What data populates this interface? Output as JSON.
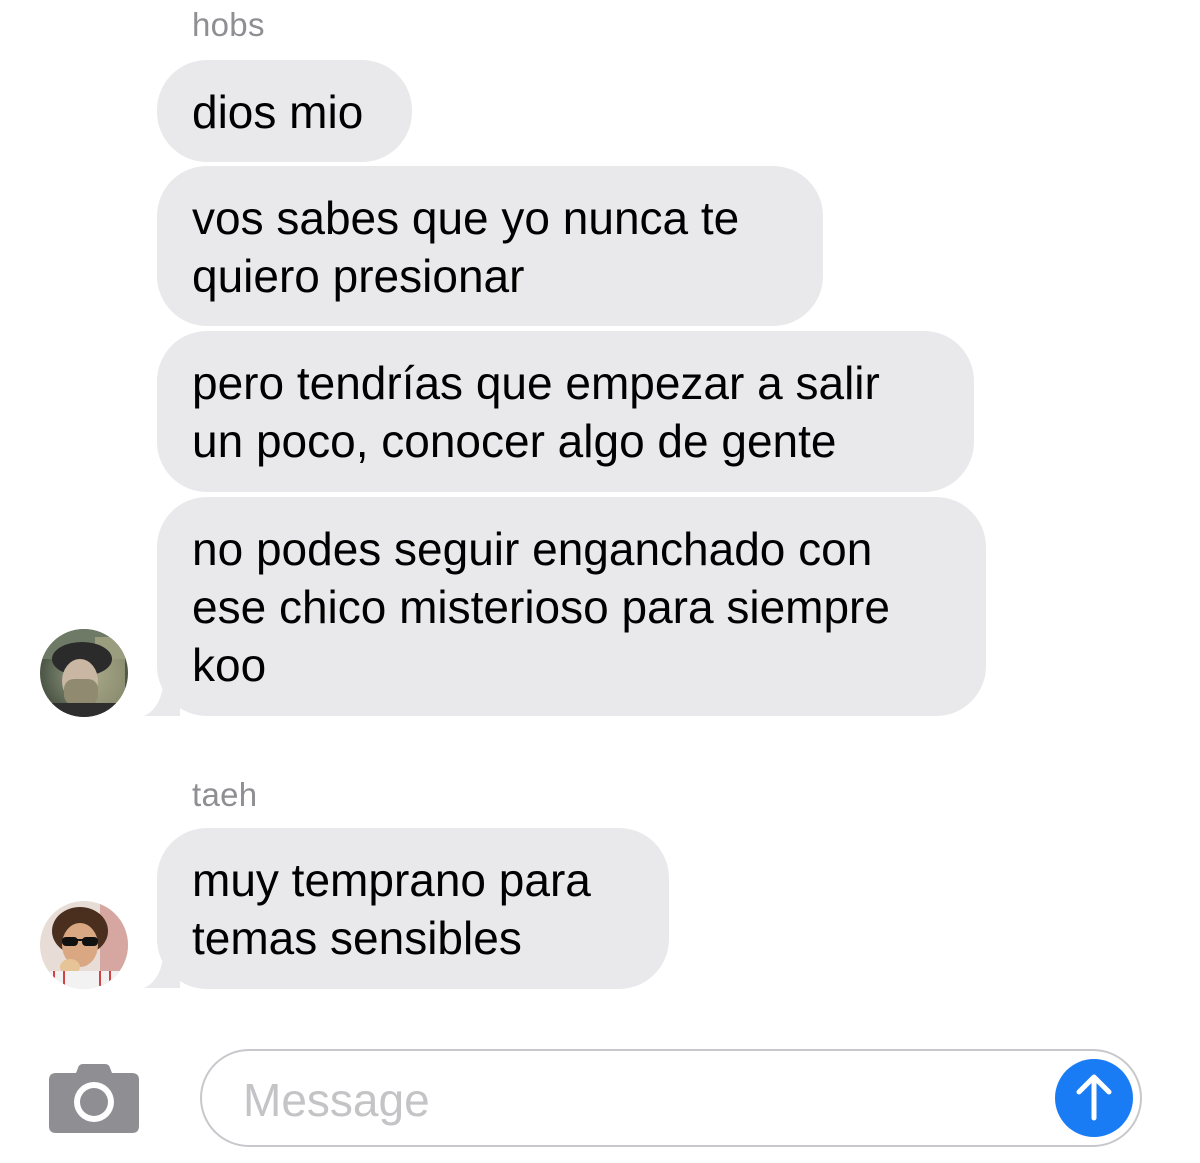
{
  "thread": {
    "groups": [
      {
        "sender": "hobs",
        "messages": [
          "dios mio",
          "vos sabes que yo nunca te\nquiero presionar",
          "pero tendrías que empezar a salir\nun poco, conocer algo de gente",
          "no podes seguir enganchado con\nese chico misterioso para siempre\nkoo"
        ],
        "avatar": "profile-photo-masked-person"
      },
      {
        "sender": "taeh",
        "messages": [
          "muy temprano para\ntemas sensibles"
        ],
        "avatar": "profile-photo-person-sunglasses"
      }
    ]
  },
  "composer": {
    "placeholder": "Message",
    "camera_icon": "camera-icon",
    "send_icon": "arrow-up-icon"
  },
  "colors": {
    "bubble_background": "#e9e9eb",
    "sender_label": "#8e8e93",
    "send_button": "#1a7cf4",
    "placeholder": "#c4c4c7"
  }
}
